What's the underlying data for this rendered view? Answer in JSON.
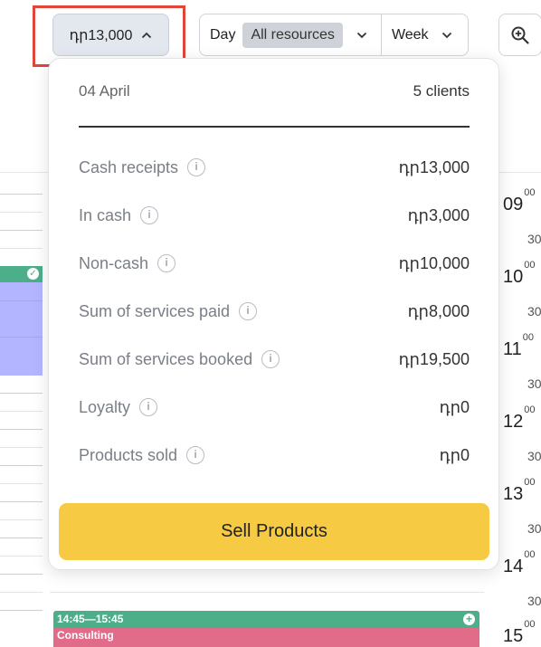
{
  "toolbar": {
    "amount": "դր13,000",
    "view_day": "Day",
    "view_resources": "All resources",
    "view_period": "Week"
  },
  "summary": {
    "date": "04 April",
    "clients": "5 clients",
    "rows": [
      {
        "label": "Cash receipts",
        "value": "դր13,000"
      },
      {
        "label": "In cash",
        "value": "դր3,000"
      },
      {
        "label": "Non-cash",
        "value": "դր10,000"
      },
      {
        "label": "Sum of services paid",
        "value": "դր8,000"
      },
      {
        "label": "Sum of services booked",
        "value": "դր19,500"
      },
      {
        "label": "Loyalty",
        "value": "դր0"
      },
      {
        "label": "Products sold",
        "value": "դր0"
      }
    ],
    "sell_button": "Sell Products"
  },
  "calendar": {
    "hours": [
      {
        "hour": "09",
        "min": "00",
        "half": "30"
      },
      {
        "hour": "10",
        "min": "00",
        "half": "30"
      },
      {
        "hour": "11",
        "min": "00",
        "half": "30"
      },
      {
        "hour": "12",
        "min": "00",
        "half": "30"
      },
      {
        "hour": "13",
        "min": "00",
        "half": "30"
      },
      {
        "hour": "14",
        "min": "00",
        "half": "30"
      },
      {
        "hour": "15",
        "min": "00",
        "half": ""
      }
    ],
    "event": {
      "time": "14:45—15:45",
      "service": "Consulting"
    }
  },
  "colors": {
    "highlight": "#e0453a",
    "sell_button": "#f6cb43",
    "event_green": "#4caf8a",
    "event_pink": "#e06c8a",
    "event_lavender": "#b3b6ff"
  },
  "icons": [
    "chevron-up-icon",
    "chevron-down-icon",
    "zoom-in-icon",
    "info-icon",
    "check-icon",
    "plus-icon"
  ]
}
